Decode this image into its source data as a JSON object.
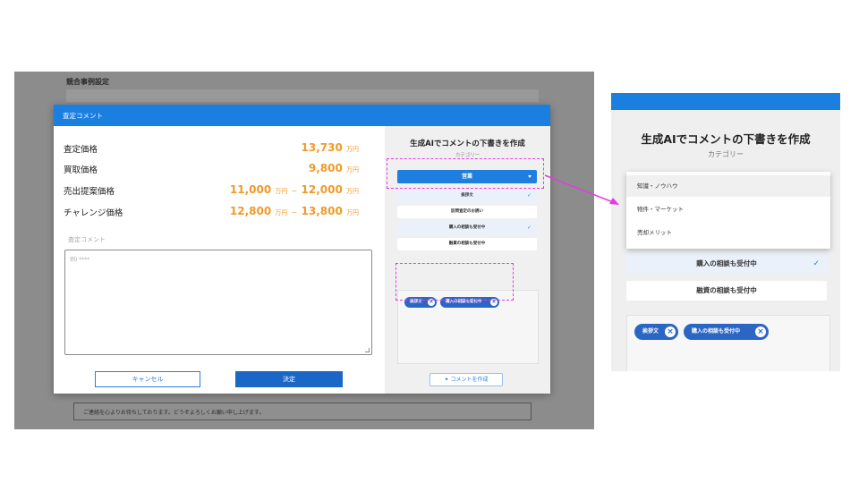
{
  "background": {
    "section_title": "競合事例設定",
    "footer_text": "ご連絡を心よりお待ちしております。どうぞよろしくお願い申し上げます。"
  },
  "modal": {
    "title": "査定コメント",
    "prices": [
      {
        "label": "査定価格",
        "value": "13,730",
        "unit": "万円"
      },
      {
        "label": "買取価格",
        "value": "9,800",
        "unit": "万円"
      },
      {
        "label": "売出提案価格",
        "value_from": "11,000",
        "value_to": "12,000",
        "unit": "万円",
        "separator": "~"
      },
      {
        "label": "チャレンジ価格",
        "value_from": "12,800",
        "value_to": "13,800",
        "unit": "万円",
        "separator": "~"
      }
    ],
    "comment_label": "査定コメント",
    "comment_placeholder": "例) ****",
    "cancel_label": "キャンセル",
    "decide_label": "決定"
  },
  "ai_panel": {
    "title": "生成AIでコメントの下書きを作成",
    "category_label": "カテゴリー",
    "selected_category": "営業",
    "options": [
      {
        "label": "挨拶文",
        "checked": true
      },
      {
        "label": "訪問査定のお誘い",
        "checked": false
      },
      {
        "label": "購入の相談も受付中",
        "checked": true
      },
      {
        "label": "融資の相談も受付中",
        "checked": false
      }
    ],
    "tags": [
      "挨拶文",
      "購入の相談も受付中"
    ],
    "create_label": "コメントを作成",
    "check_glyph": "✓",
    "remove_glyph": "×"
  },
  "zoom_panel": {
    "title": "生成AIでコメントの下書きを作成",
    "category_label": "カテゴリー",
    "menu_items": [
      "知識・ノウハウ",
      "物件・マーケット",
      "売却メリット"
    ],
    "options": [
      {
        "label": "購入の相談も受付中",
        "checked": true
      },
      {
        "label": "融資の相談も受付中",
        "checked": false
      }
    ],
    "tags": [
      "挨拶文",
      "購入の相談も受付中"
    ]
  },
  "colors": {
    "primary": "#1b7fe0",
    "price_accent": "#f19a28",
    "annotation": "#e23ce2",
    "tag": "#2c66c5"
  }
}
